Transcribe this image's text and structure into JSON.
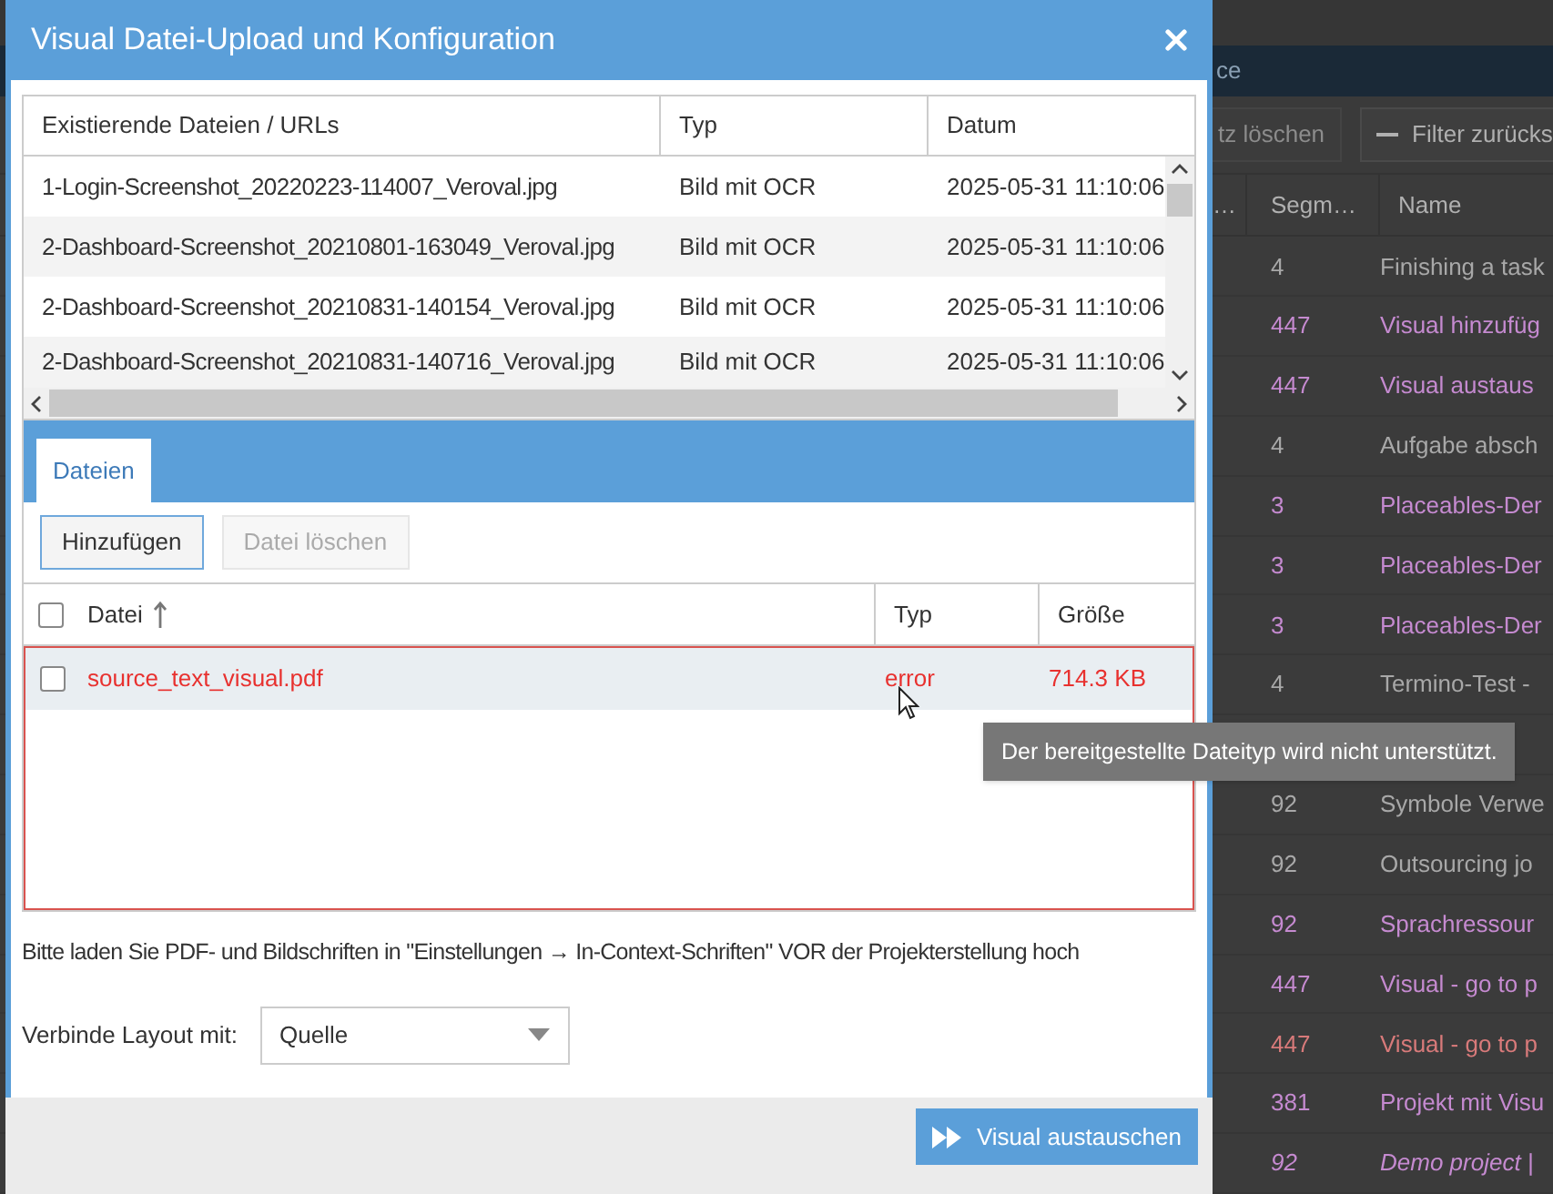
{
  "background": {
    "header_text": "ce",
    "toolbar": [
      {
        "label": "tz löschen",
        "kind": "disabled"
      },
      {
        "label": "Filter zurücks",
        "kind": "minus"
      }
    ],
    "columns": [
      "…",
      "Segm…",
      "Name"
    ],
    "rows": [
      {
        "kind": "row",
        "segments": "4",
        "name": "Finishing a task",
        "color": "#a8a8a8"
      },
      {
        "kind": "row",
        "segments": "447",
        "name": "Visual hinzufüg",
        "color": "#c58ad0"
      },
      {
        "kind": "row",
        "segments": "447",
        "name": "Visual austaus",
        "color": "#c58ad0"
      },
      {
        "kind": "row",
        "segments": "4",
        "name": "Aufgabe absch",
        "color": "#a8a8a8"
      },
      {
        "kind": "row",
        "segments": "3",
        "name": "Placeables-Der",
        "color": "#c58ad0"
      },
      {
        "kind": "row",
        "segments": "3",
        "name": "Placeables-Der",
        "color": "#c58ad0"
      },
      {
        "kind": "row",
        "segments": "3",
        "name": "Placeables-Der",
        "color": "#c58ad0"
      },
      {
        "kind": "row",
        "segments": "4",
        "name": "Termino-Test -",
        "color": "#a8a8a8"
      },
      {
        "kind": "covered"
      },
      {
        "kind": "row",
        "segments": "92",
        "name": "Symbole Verwe",
        "color": "#a8a8a8"
      },
      {
        "kind": "row",
        "segments": "92",
        "name": "Outsourcing jo",
        "color": "#a8a8a8"
      },
      {
        "kind": "row",
        "segments": "92",
        "name": "Sprachressour",
        "color": "#c58ad0"
      },
      {
        "kind": "row",
        "segments": "447",
        "name": "Visual - go to p",
        "color": "#c58ad0"
      },
      {
        "kind": "row",
        "segments": "447",
        "name": "Visual - go to p",
        "color": "#d87a7a"
      },
      {
        "kind": "row",
        "segments": "381",
        "name": "Projekt mit Visu",
        "color": "#c58ad0"
      },
      {
        "kind": "italic",
        "segments": "92",
        "name": "Demo project |",
        "color": "#c58ad0"
      }
    ]
  },
  "dialog": {
    "title": "Visual Datei-Upload und Konfiguration",
    "existing_files": {
      "columns": [
        "Existierende Dateien / URLs",
        "Typ",
        "Datum"
      ],
      "rows": [
        {
          "file": "1-Login-Screenshot_20220223-114007_Veroval.jpg",
          "type": "Bild mit OCR",
          "date": "2025-05-31 11:10:06"
        },
        {
          "file": "2-Dashboard-Screenshot_20210801-163049_Veroval.jpg",
          "type": "Bild mit OCR",
          "date": "2025-05-31 11:10:06"
        },
        {
          "file": "2-Dashboard-Screenshot_20210831-140154_Veroval.jpg",
          "type": "Bild mit OCR",
          "date": "2025-05-31 11:10:06"
        },
        {
          "file": "2-Dashboard-Screenshot_20210831-140716_Veroval.jpg",
          "type": "Bild mit OCR",
          "date": "2025-05-31 11:10:06"
        }
      ]
    },
    "tabs": [
      {
        "label": "Dateien",
        "selected": true
      }
    ],
    "toolbar": [
      {
        "label": "Hinzufügen",
        "disabled": false
      },
      {
        "label": "Datei löschen",
        "disabled": true
      }
    ],
    "uploads": {
      "all_checked": false,
      "columns": [
        {
          "label": "Datei",
          "sorted": true
        },
        {
          "label": "Typ",
          "sorted": false
        },
        {
          "label": "Größe",
          "sorted": false
        }
      ],
      "rows": [
        {
          "name": "source_text_visual.pdf",
          "type": "error",
          "size": "714.3 KB",
          "checked": false,
          "failed": true
        }
      ]
    },
    "hint": "Bitte laden Sie PDF- und Bildschriften in \"Einstellungen → In-Context-Schriften\" VOR der Projekterstellung hoch",
    "layout": {
      "label": "Verbinde Layout mit:",
      "value": "Quelle"
    },
    "submit": "Visual austauschen"
  },
  "tooltip": "Der bereitgestellte Dateityp wird nicht unterstützt."
}
